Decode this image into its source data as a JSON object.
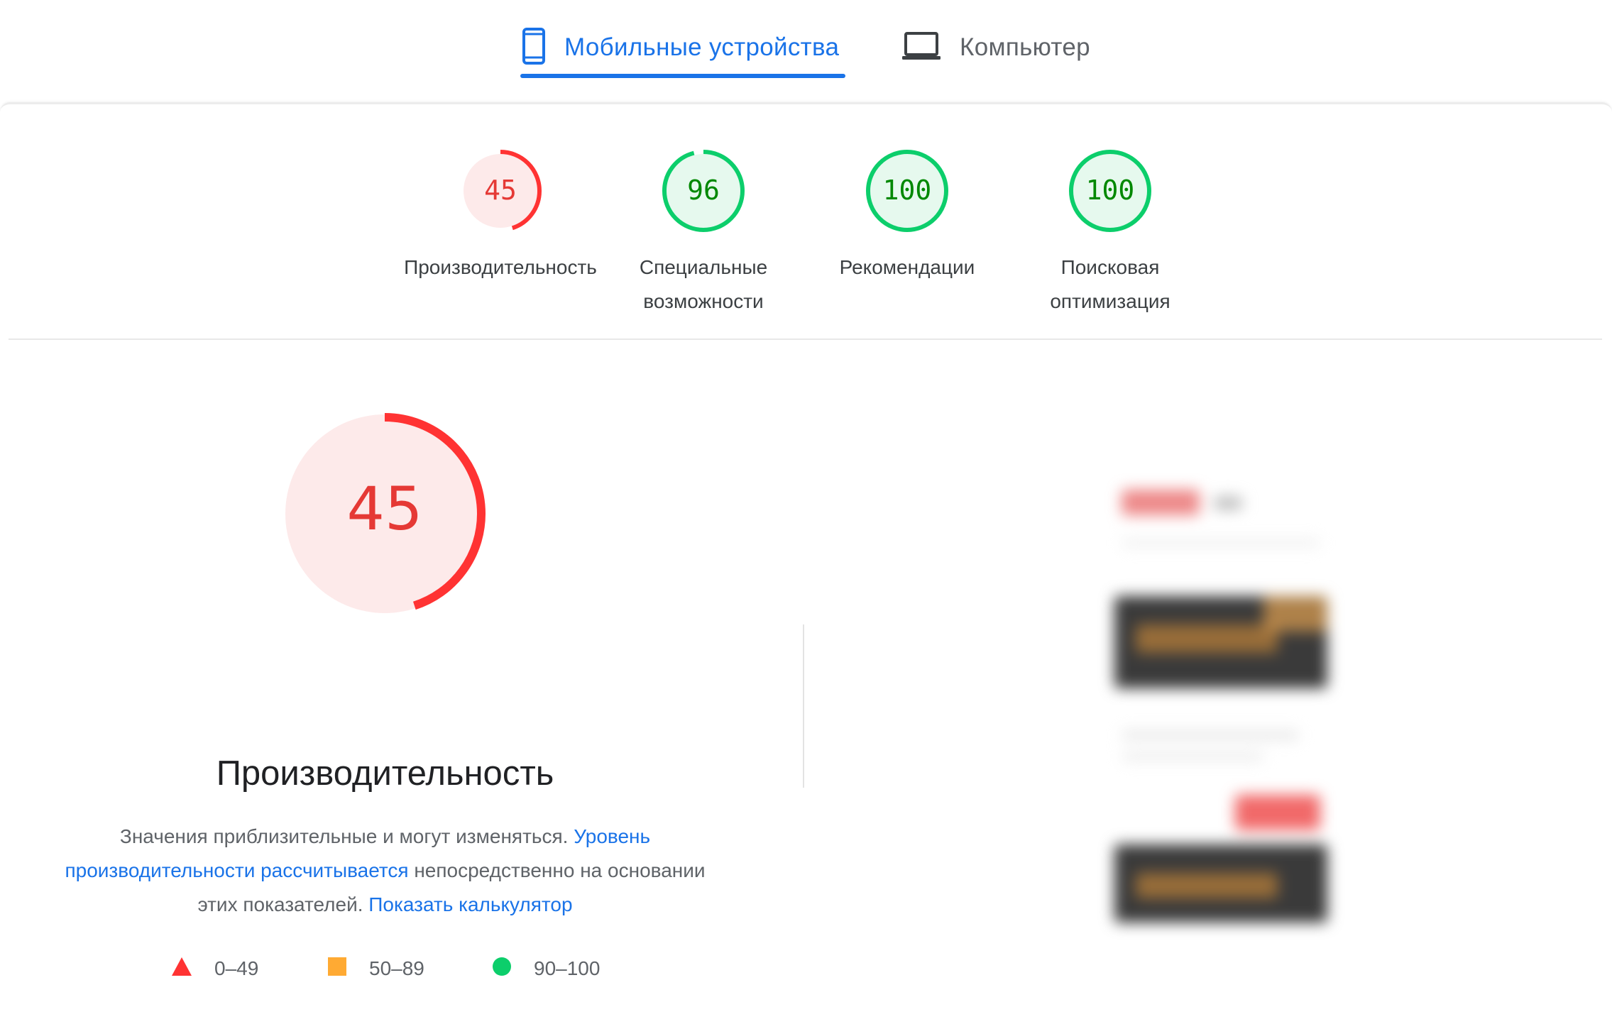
{
  "tabs": [
    {
      "label": "Мобильные устройства",
      "icon": "smartphone-icon",
      "active": true
    },
    {
      "label": "Компьютер",
      "icon": "laptop-icon",
      "active": false
    }
  ],
  "scores": [
    {
      "value": "45",
      "label_line1": "Производительность",
      "label_line2": "",
      "score": 45,
      "status": "fail"
    },
    {
      "value": "96",
      "label_line1": "Специальные",
      "label_line2": "возможности",
      "score": 96,
      "status": "pass"
    },
    {
      "value": "100",
      "label_line1": "Рекомендации",
      "label_line2": "",
      "score": 100,
      "status": "pass"
    },
    {
      "value": "100",
      "label_line1": "Поисковая",
      "label_line2": "оптимизация",
      "score": 100,
      "status": "pass"
    }
  ],
  "performance": {
    "score_text": "45",
    "score": 45,
    "title": "Производительность",
    "desc_text1": "Значения приблизительные и могут изменяться. ",
    "desc_link1": "Уровень производительности рассчитывается",
    "desc_text2": " непосредственно на основании этих показателей. ",
    "desc_link2": "Показать калькулятор"
  },
  "legend": [
    {
      "range": "0–49",
      "shape": "triangle",
      "color": "#f33"
    },
    {
      "range": "50–89",
      "shape": "square",
      "color": "#ffaa33"
    },
    {
      "range": "90–100",
      "shape": "circle",
      "color": "#0cce6b"
    }
  ],
  "colors": {
    "accent": "#1a73e8",
    "fail": "#ff3333",
    "fail_bg": "#fdeaea",
    "pass_text": "#008800",
    "pass_ring": "#0cce6b",
    "pass_bg": "#e6f9ee"
  }
}
